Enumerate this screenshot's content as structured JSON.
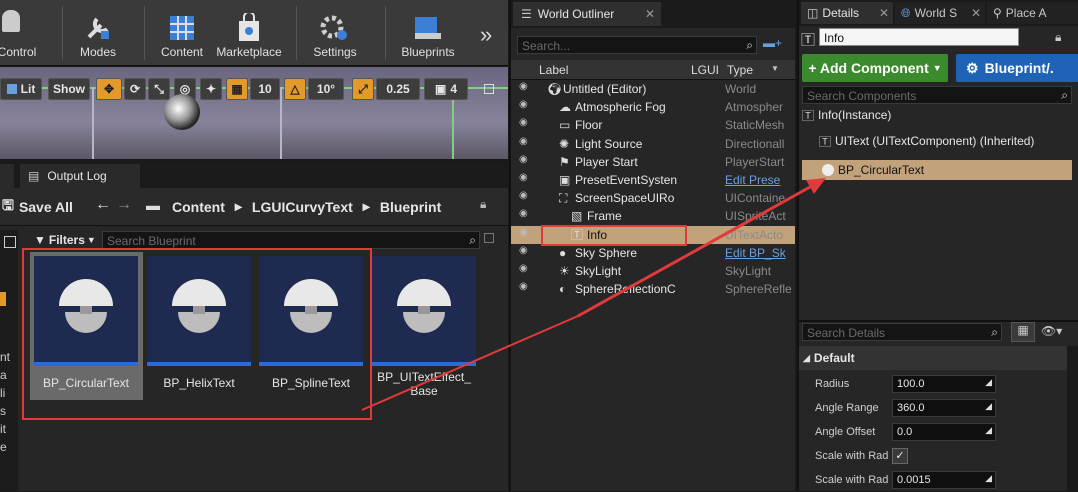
{
  "toolbar": {
    "items": [
      "Control",
      "Modes",
      "Content",
      "Marketplace",
      "Settings",
      "Blueprints"
    ],
    "overflow": "»"
  },
  "viewport": {
    "lit": "Lit",
    "show": "Show",
    "grid_snap": "10",
    "rotate_snap": "10°",
    "scale_snap": "0.25",
    "camera_speed": "4"
  },
  "content_browser": {
    "tab": "Output Log",
    "save_all": "Save All",
    "breadcrumb": [
      "Content",
      "LGUICurvyText",
      "Blueprint"
    ],
    "filters": "Filters",
    "search_placeholder": "Search Blueprint",
    "left_letters": [
      "nt",
      "a",
      "li",
      "s",
      "it",
      "e"
    ],
    "assets": [
      {
        "name": "BP_CircularText"
      },
      {
        "name": "BP_HelixText"
      },
      {
        "name": "BP_SplineText"
      },
      {
        "name": "BP_UITextEffect_\nBase"
      }
    ]
  },
  "outliner": {
    "tab": "World Outliner",
    "search_placeholder": "Search...",
    "columns": [
      "Label",
      "LGUI",
      "Type"
    ],
    "rows": [
      {
        "label": "Untitled (Editor)",
        "type": "World",
        "indent": 0
      },
      {
        "label": "Atmospheric Fog",
        "type": "Atmospher",
        "indent": 1
      },
      {
        "label": "Floor",
        "type": "StaticMesh",
        "indent": 1
      },
      {
        "label": "Light Source",
        "type": "Directionall",
        "indent": 1
      },
      {
        "label": "Player Start",
        "type": "PlayerStart",
        "indent": 1
      },
      {
        "label": "PresetEventSysten",
        "type": "Edit Prese",
        "indent": 1
      },
      {
        "label": "ScreenSpaceUIRo",
        "type": "UIContaine",
        "indent": 1
      },
      {
        "label": "Frame",
        "type": "UISpriteAct",
        "indent": 2
      },
      {
        "label": "Info",
        "type": "UITextActo",
        "indent": 2
      },
      {
        "label": "Sky Sphere",
        "type": "Edit BP_Sk",
        "indent": 1
      },
      {
        "label": "SkyLight",
        "type": "SkyLight",
        "indent": 1
      },
      {
        "label": "SphereReflectionC",
        "type": "SphereRefle",
        "indent": 1
      }
    ]
  },
  "details": {
    "tabs": [
      "Details",
      "World S",
      "Place A"
    ],
    "name": "Info",
    "add_component": "+ Add Component",
    "blueprint": "Blueprint/.",
    "search_components": "Search Components",
    "instance": "Info(Instance)",
    "component": "UIText (UITextComponent) (Inherited)",
    "selected_component": "BP_CircularText",
    "search_details": "Search Details",
    "category": "Default",
    "props": [
      {
        "label": "Radius",
        "value": "100.0"
      },
      {
        "label": "Angle Range",
        "value": "360.0"
      },
      {
        "label": "Angle Offset",
        "value": "0.0"
      },
      {
        "label": "Scale with Rad",
        "value": "checked"
      },
      {
        "label": "Scale with Rad",
        "value": "0.0015"
      }
    ]
  },
  "colors": {
    "annotation": "#e03a3a",
    "add_component": "#3c8a2e",
    "blueprint": "#1e63b5",
    "selected_row": "#c2a27a",
    "asset_bar": "#2b6ad9"
  }
}
